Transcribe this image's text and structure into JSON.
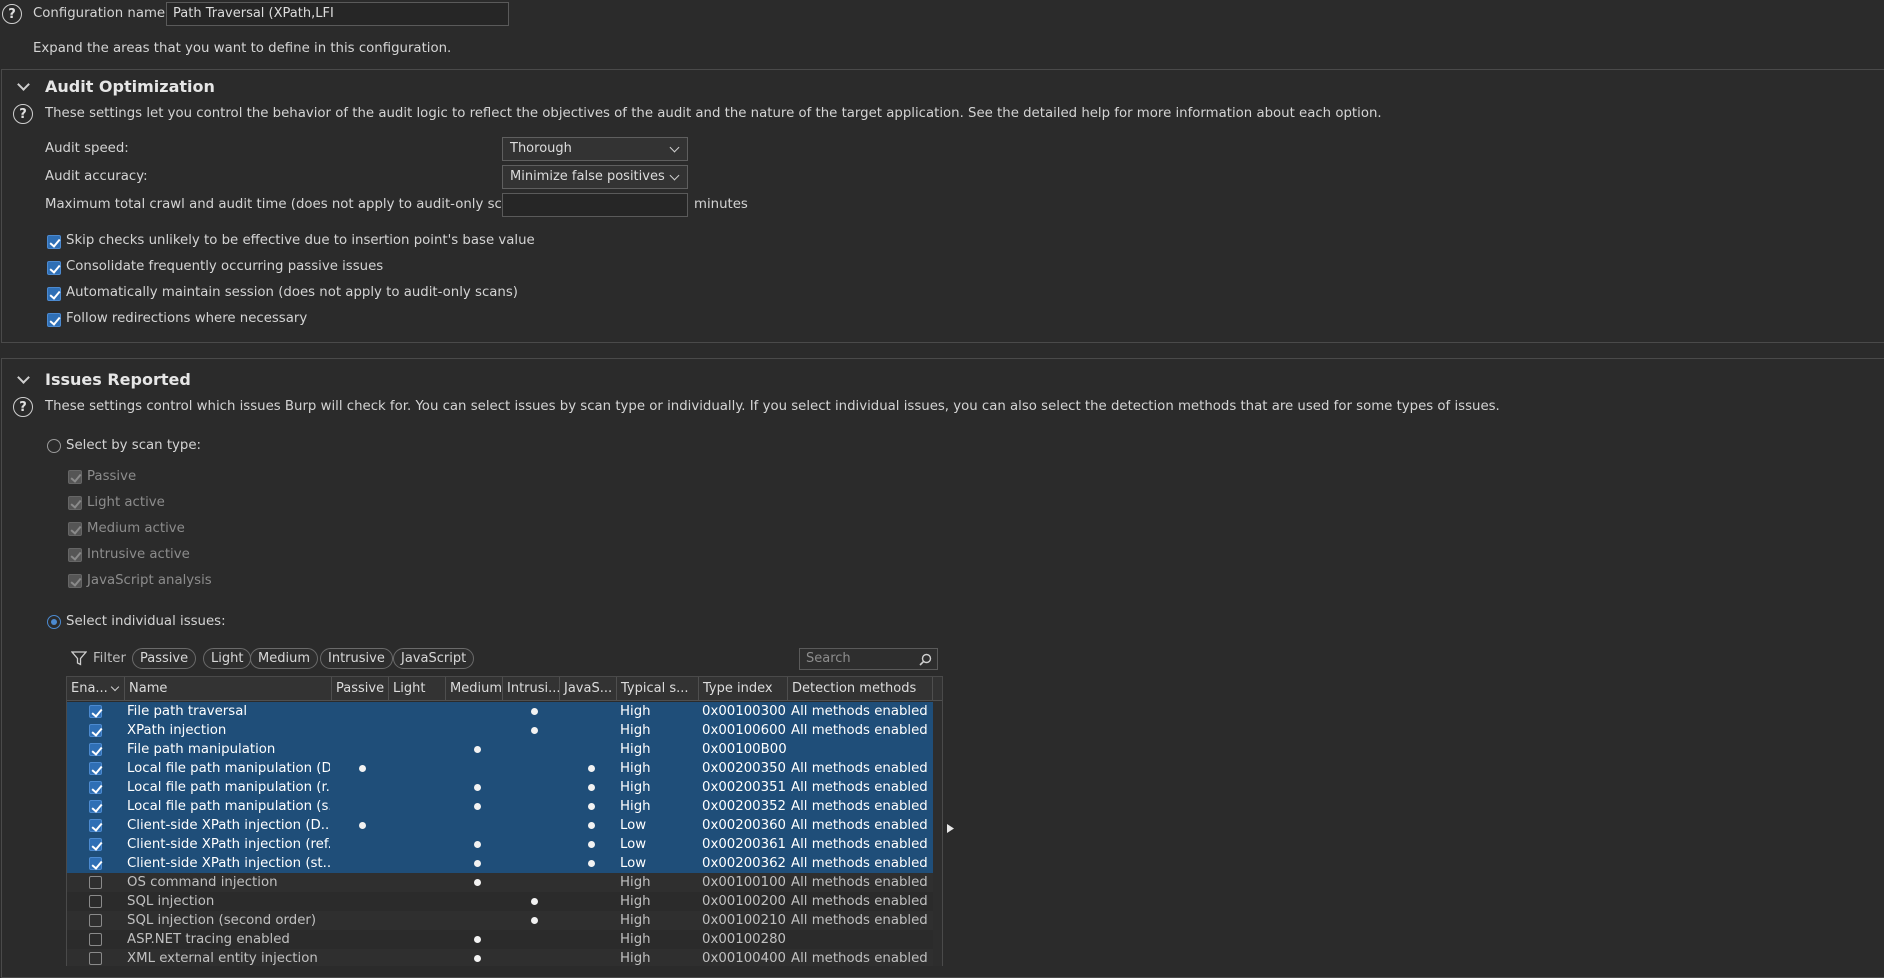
{
  "config": {
    "name_label": "Configuration name:",
    "name_value": "Path Traversal (XPath,LFI",
    "expand_hint": "Expand the areas that you want to define in this configuration."
  },
  "audit_opt": {
    "title": "Audit Optimization",
    "description": "These settings let you control the behavior of the audit logic to reflect the objectives of the audit and the nature of the target application. See the detailed help for more information about each option.",
    "speed_label": "Audit speed:",
    "speed_value": "Thorough",
    "accuracy_label": "Audit accuracy:",
    "accuracy_value": "Minimize false positives",
    "max_time_label": "Maximum total crawl and audit time (does not apply to audit-only scans):",
    "max_time_value": "",
    "minutes_label": "minutes",
    "checkboxes": [
      {
        "label": "Skip checks unlikely to be effective due to insertion point's base value",
        "checked": true
      },
      {
        "label": "Consolidate frequently occurring passive issues",
        "checked": true
      },
      {
        "label": "Automatically maintain session (does not apply to audit-only scans)",
        "checked": true
      },
      {
        "label": "Follow redirections where necessary",
        "checked": true
      }
    ]
  },
  "issues": {
    "title": "Issues Reported",
    "description": "These settings control which issues Burp will check for. You can select issues by scan type or individually. If you select individual issues, you can also select the detection methods that are used for some types of issues.",
    "by_scan_type_label": "Select by scan type:",
    "scan_types": [
      "Passive",
      "Light active",
      "Medium active",
      "Intrusive active",
      "JavaScript analysis"
    ],
    "individual_label": "Select individual issues:",
    "filter_label": "Filter",
    "filter_pills": [
      "Passive",
      "Light",
      "Medium",
      "Intrusive",
      "JavaScript"
    ],
    "search_placeholder": "Search",
    "columns": [
      "Ena...",
      "Name",
      "Passive",
      "Light",
      "Medium",
      "Intrusi...",
      "JavaS...",
      "Typical s...",
      "Type index",
      "Detection methods"
    ],
    "rows": [
      {
        "enabled": true,
        "name": "File path traversal",
        "passive": false,
        "light": false,
        "medium": false,
        "intrusive": true,
        "js": false,
        "severity": "High",
        "type_index": "0x00100300",
        "detection": "All methods enabled"
      },
      {
        "enabled": true,
        "name": "XPath injection",
        "passive": false,
        "light": false,
        "medium": false,
        "intrusive": true,
        "js": false,
        "severity": "High",
        "type_index": "0x00100600",
        "detection": "All methods enabled"
      },
      {
        "enabled": true,
        "name": "File path manipulation",
        "passive": false,
        "light": false,
        "medium": true,
        "intrusive": false,
        "js": false,
        "severity": "High",
        "type_index": "0x00100B00",
        "detection": ""
      },
      {
        "enabled": true,
        "name": "Local file path manipulation (D...",
        "passive": true,
        "light": false,
        "medium": false,
        "intrusive": false,
        "js": true,
        "severity": "High",
        "type_index": "0x00200350",
        "detection": "All methods enabled"
      },
      {
        "enabled": true,
        "name": "Local file path manipulation (r...",
        "passive": false,
        "light": false,
        "medium": true,
        "intrusive": false,
        "js": true,
        "severity": "High",
        "type_index": "0x00200351",
        "detection": "All methods enabled"
      },
      {
        "enabled": true,
        "name": "Local file path manipulation (s...",
        "passive": false,
        "light": false,
        "medium": true,
        "intrusive": false,
        "js": true,
        "severity": "High",
        "type_index": "0x00200352",
        "detection": "All methods enabled"
      },
      {
        "enabled": true,
        "name": "Client-side XPath injection (D...",
        "passive": true,
        "light": false,
        "medium": false,
        "intrusive": false,
        "js": true,
        "severity": "Low",
        "type_index": "0x00200360",
        "detection": "All methods enabled"
      },
      {
        "enabled": true,
        "name": "Client-side XPath injection (ref...",
        "passive": false,
        "light": false,
        "medium": true,
        "intrusive": false,
        "js": true,
        "severity": "Low",
        "type_index": "0x00200361",
        "detection": "All methods enabled"
      },
      {
        "enabled": true,
        "name": "Client-side XPath injection (st...",
        "passive": false,
        "light": false,
        "medium": true,
        "intrusive": false,
        "js": true,
        "severity": "Low",
        "type_index": "0x00200362",
        "detection": "All methods enabled"
      },
      {
        "enabled": false,
        "name": "OS command injection",
        "passive": false,
        "light": false,
        "medium": true,
        "intrusive": false,
        "js": false,
        "severity": "High",
        "type_index": "0x00100100",
        "detection": "All methods enabled"
      },
      {
        "enabled": false,
        "name": "SQL injection",
        "passive": false,
        "light": false,
        "medium": false,
        "intrusive": true,
        "js": false,
        "severity": "High",
        "type_index": "0x00100200",
        "detection": "All methods enabled"
      },
      {
        "enabled": false,
        "name": "SQL injection (second order)",
        "passive": false,
        "light": false,
        "medium": false,
        "intrusive": true,
        "js": false,
        "severity": "High",
        "type_index": "0x00100210",
        "detection": "All methods enabled"
      },
      {
        "enabled": false,
        "name": "ASP.NET tracing enabled",
        "passive": false,
        "light": false,
        "medium": true,
        "intrusive": false,
        "js": false,
        "severity": "High",
        "type_index": "0x00100280",
        "detection": ""
      },
      {
        "enabled": false,
        "name": "XML external entity injection",
        "passive": false,
        "light": false,
        "medium": true,
        "intrusive": false,
        "js": false,
        "severity": "High",
        "type_index": "0x00100400",
        "detection": "All methods enabled"
      }
    ]
  }
}
